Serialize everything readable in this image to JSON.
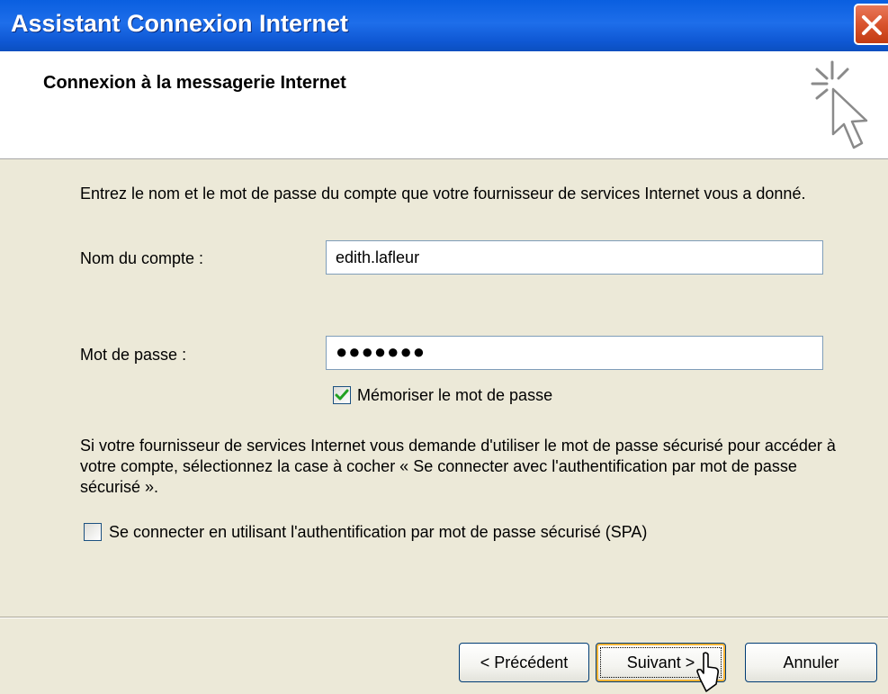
{
  "window": {
    "title": "Assistant Connexion Internet"
  },
  "header": {
    "title": "Connexion à la messagerie Internet"
  },
  "form": {
    "intro": "Entrez le nom et le mot de passe du compte que votre fournisseur de services Internet vous a donné.",
    "account_label": "Nom du compte :",
    "account_value": "edith.lafleur",
    "password_label": "Mot de passe :",
    "password_mask": "●●●●●●●",
    "remember_label": "Mémoriser le mot de passe",
    "remember_checked": true,
    "spa_info": "Si votre fournisseur de services Internet vous demande d'utiliser le mot de passe sécurisé pour accéder à votre compte, sélectionnez la case à cocher « Se connecter avec l'authentification par mot de passe sécurisé ».",
    "spa_label": "Se connecter en utilisant l'authentification par mot de passe sécurisé (SPA)",
    "spa_checked": false
  },
  "buttons": {
    "previous": "< Précédent",
    "next": "Suivant >",
    "cancel": "Annuler"
  },
  "colors": {
    "titlebar": "#0A5FE0",
    "dialog_bg": "#ECE9D8",
    "checkmark": "#21A121",
    "close": "#D9542E"
  },
  "icons": {
    "close": "close-icon",
    "wizard": "wizard-cursor-icon",
    "checkbox_check": "checkmark-icon",
    "pointer": "mouse-pointer-icon"
  }
}
